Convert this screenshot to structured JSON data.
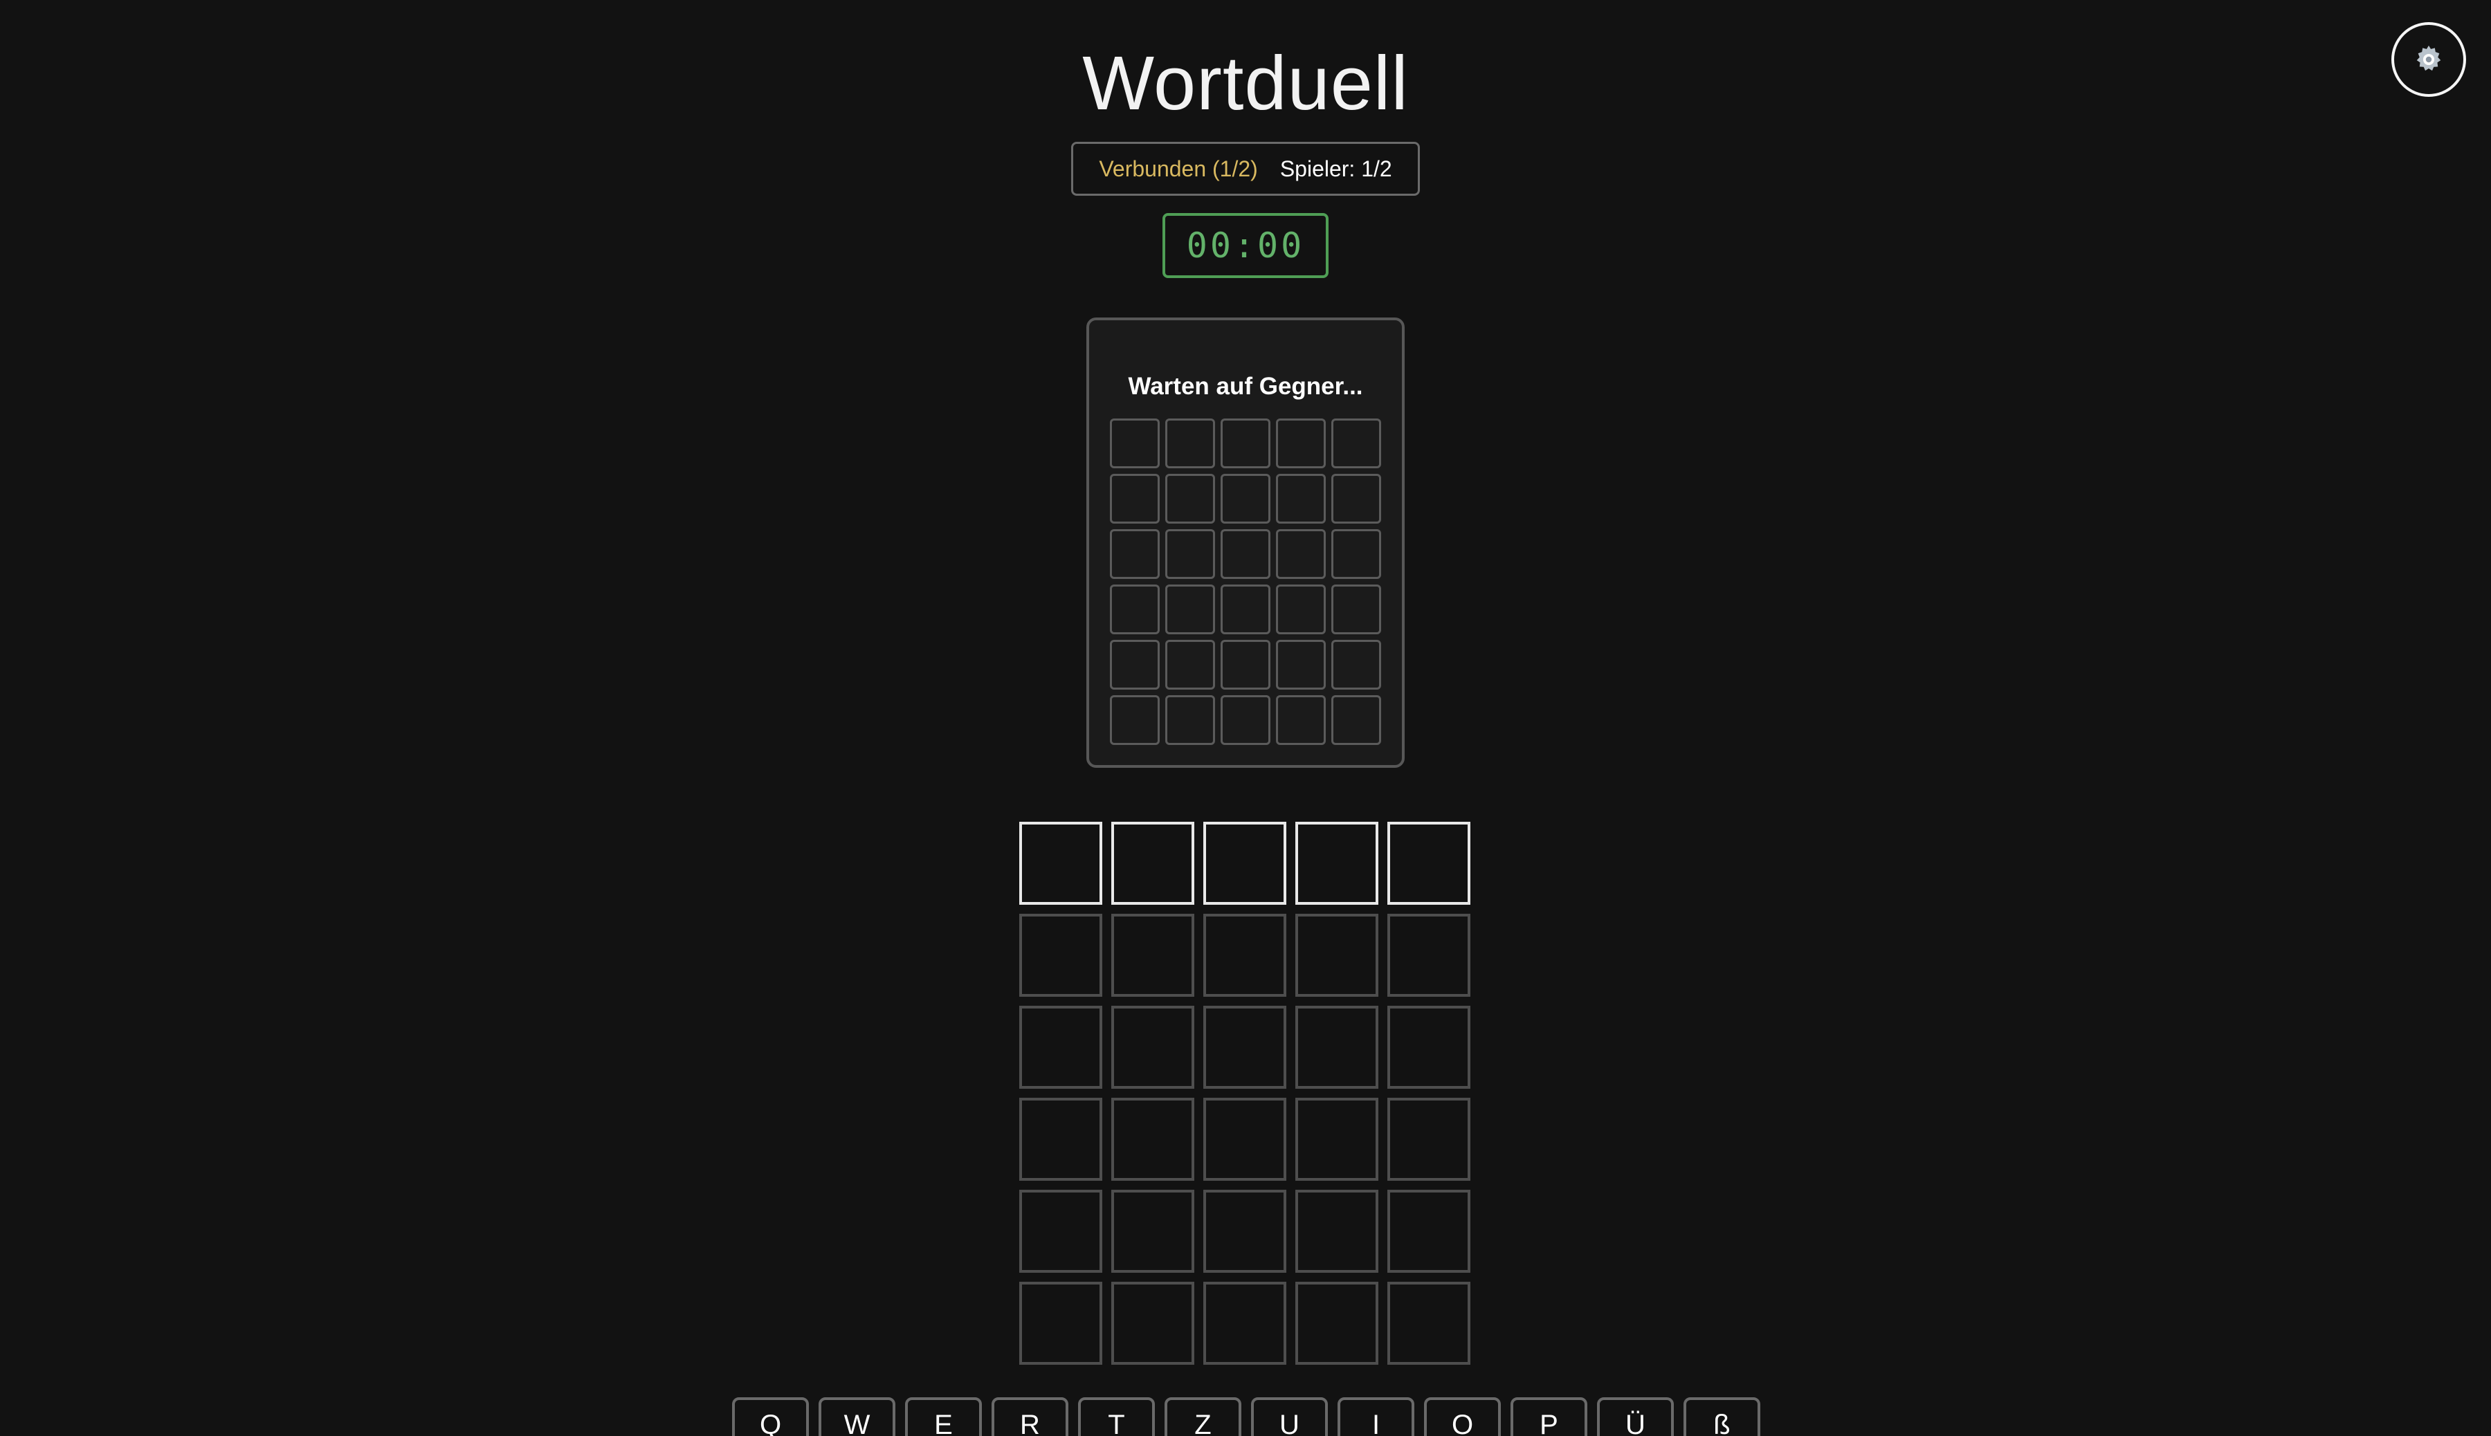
{
  "header": {
    "title": "Wortduell",
    "settings_icon": "gear-icon"
  },
  "status": {
    "connection": "Verbunden (1/2)",
    "players": "Spieler: 1/2"
  },
  "timer": {
    "value": "00:00"
  },
  "opponent": {
    "status_text": "Warten auf Gegner...",
    "rows": 6,
    "cols": 5
  },
  "board": {
    "rows": 6,
    "cols": 5,
    "active_row": 0
  },
  "keyboard": {
    "row1": [
      "Q",
      "W",
      "E",
      "R",
      "T",
      "Z",
      "U",
      "I",
      "O",
      "P",
      "Ü",
      "ß"
    ]
  },
  "colors": {
    "background": "#121212",
    "connected": "#d9b960",
    "timer": "#63b26a"
  }
}
